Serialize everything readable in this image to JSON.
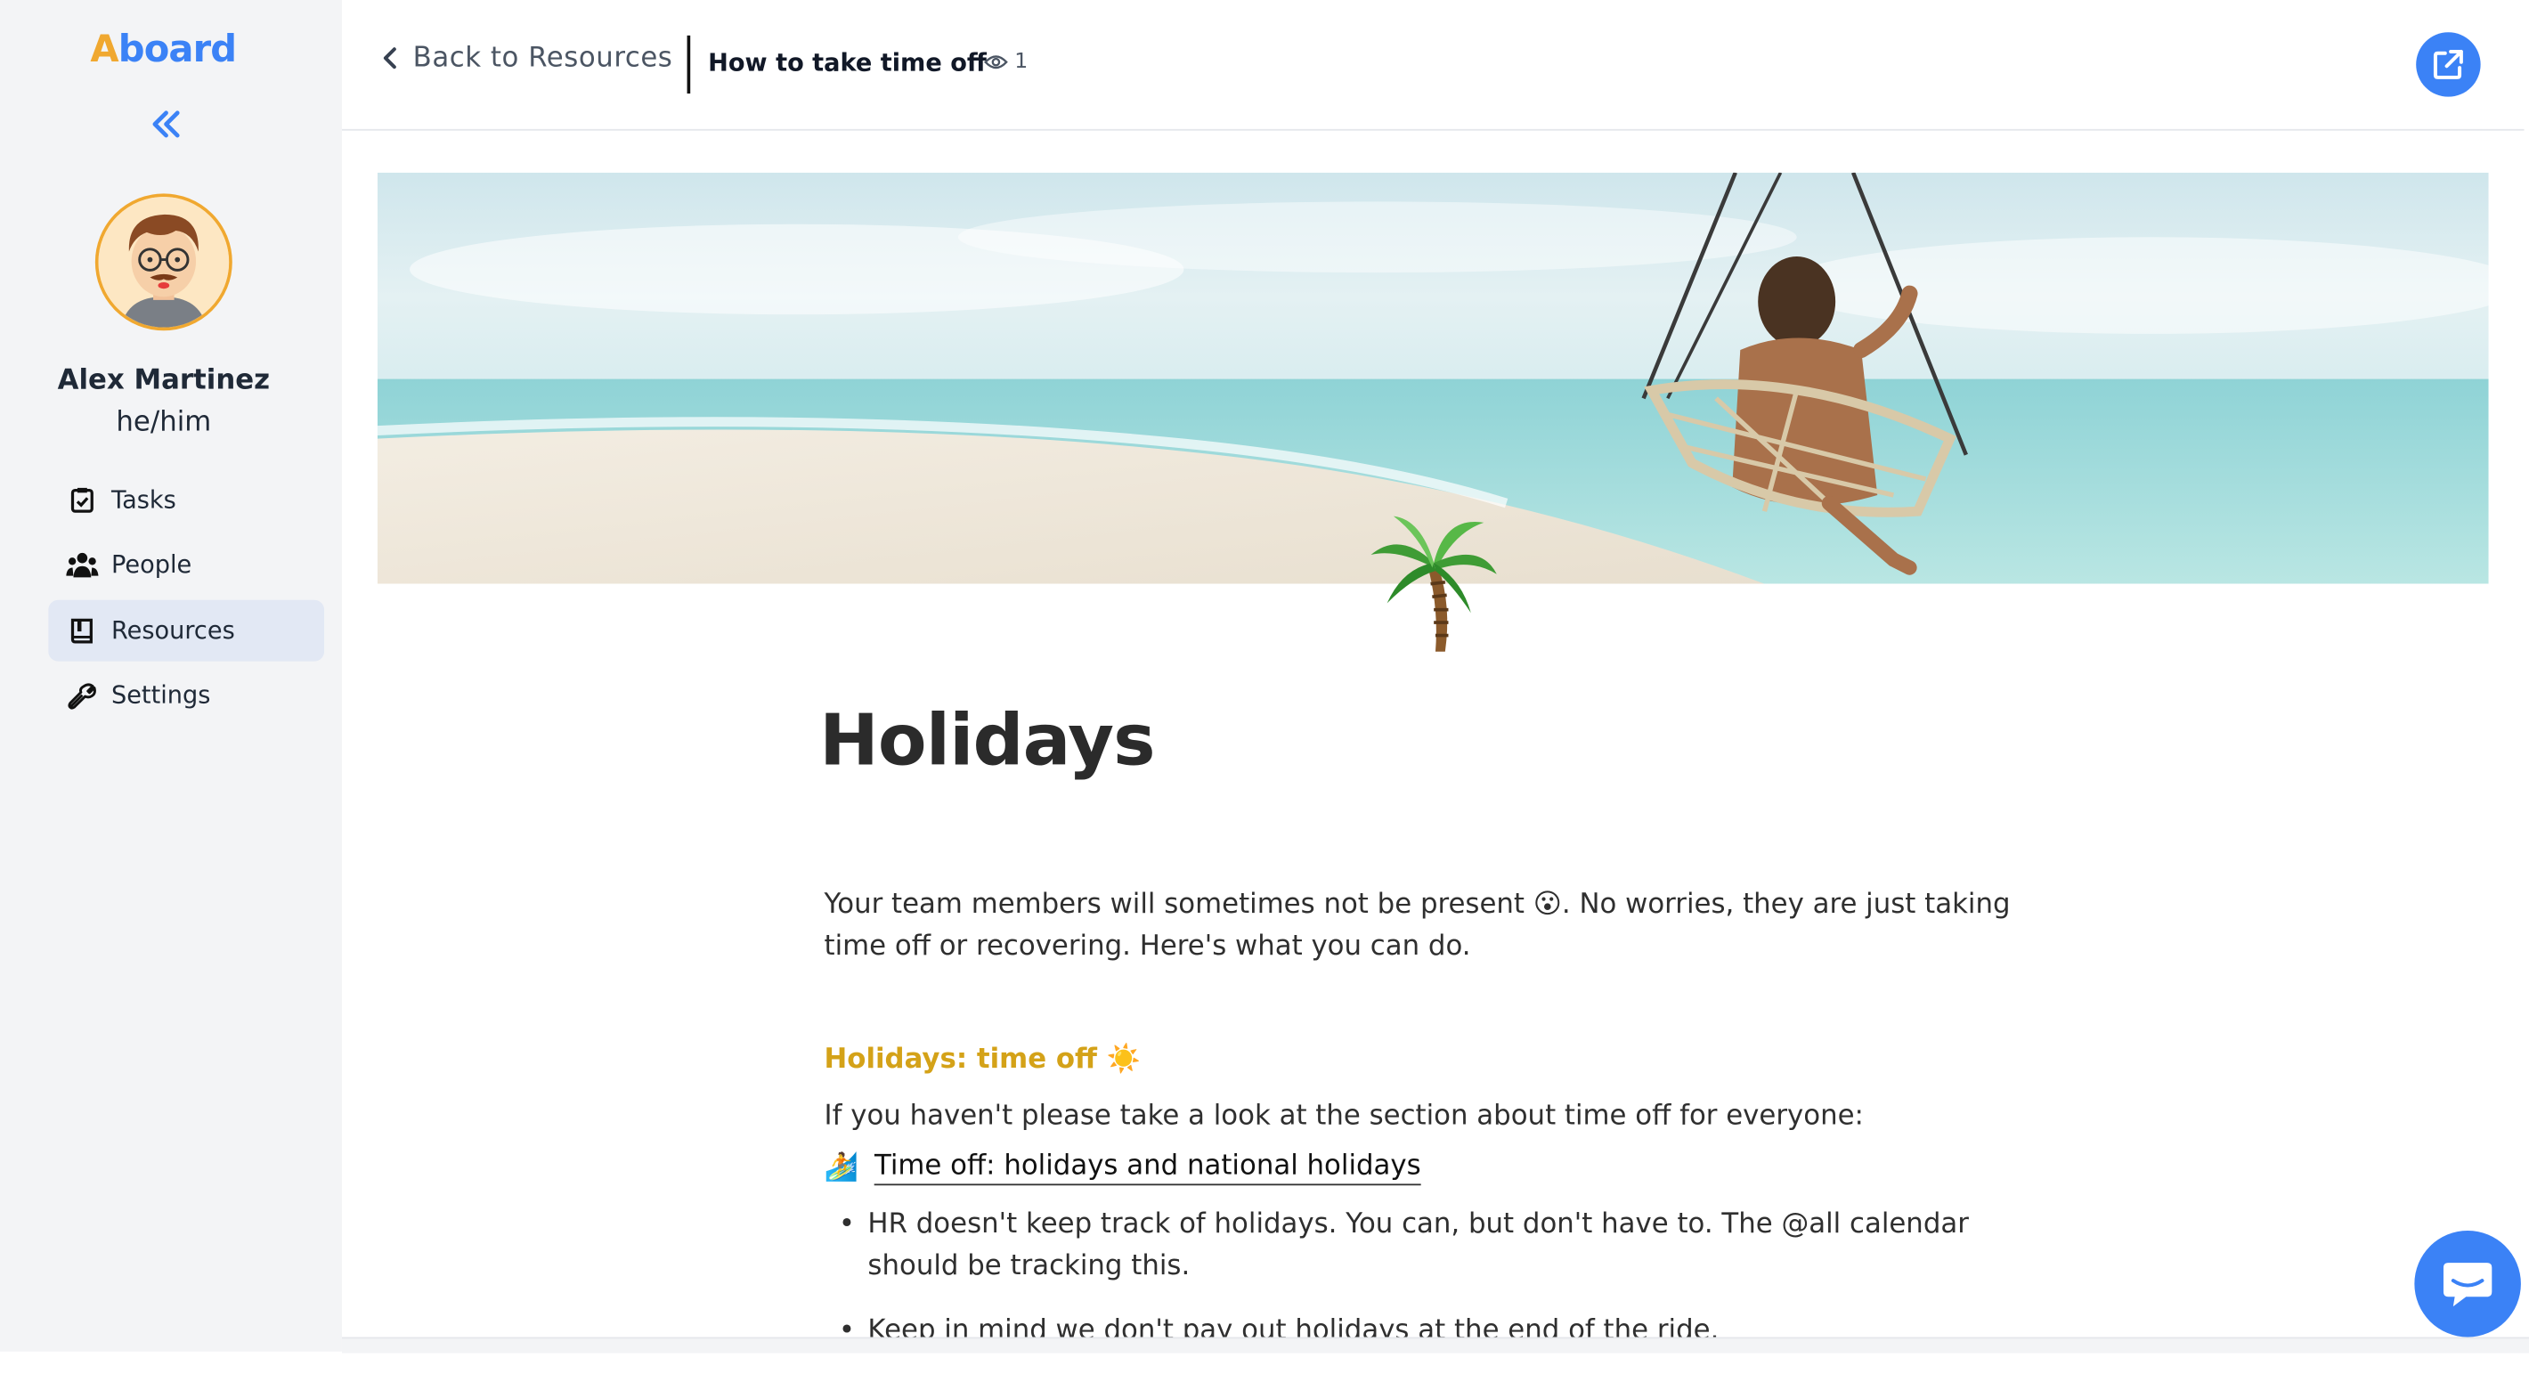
{
  "app": {
    "logo_a": "A",
    "logo_rest": "board"
  },
  "user": {
    "name": "Alex Martinez",
    "pronouns": "he/him"
  },
  "sidebar": {
    "items": [
      {
        "label": "Tasks",
        "icon": "clipboard-check-icon"
      },
      {
        "label": "People",
        "icon": "people-icon"
      },
      {
        "label": "Resources",
        "icon": "book-icon",
        "active": true
      },
      {
        "label": "Settings",
        "icon": "wrench-icon"
      }
    ]
  },
  "header": {
    "back_label": "Back to Resources",
    "title": "How to take time off",
    "view_count": "1"
  },
  "doc": {
    "title": "Holidays",
    "intro_part1": "Your team members will sometimes not be present",
    "intro_emoji": "😮",
    "intro_part2": ". No worries, they are just taking time off or recovering. Here's what you can do.",
    "section_heading": "Holidays: time off",
    "section_emoji": "☀️",
    "section_text": "If you haven't please take a look at the section about time off for everyone:",
    "link_emoji": "🏄",
    "link_text": "Time off: holidays and national holidays",
    "bullets": [
      "HR doesn't keep track of holidays. You can, but don't have to. The @all calendar should be tracking this.",
      "Keep in mind we don't pay out holidays at the end of the ride."
    ]
  },
  "colors": {
    "accent": "#3b82f6",
    "brand_orange": "#f0a830",
    "section_heading": "#d4a218"
  }
}
